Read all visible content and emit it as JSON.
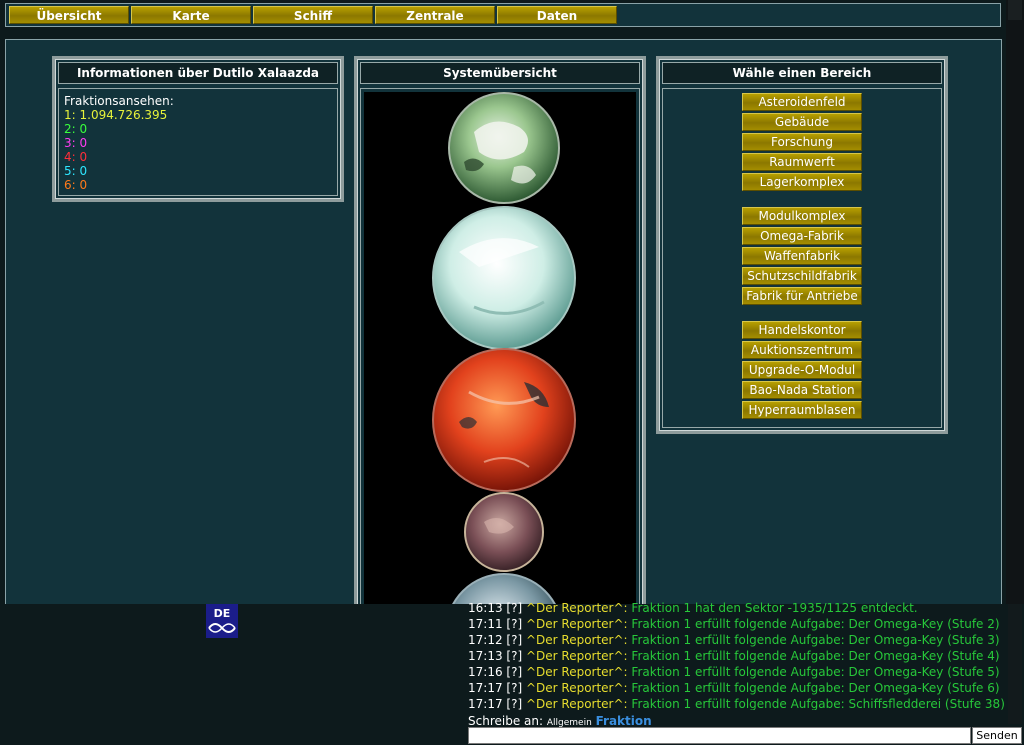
{
  "nav": [
    "Übersicht",
    "Karte",
    "Schiff",
    "Zentrale",
    "Daten"
  ],
  "info": {
    "title": "Informationen über Dutilo Xalaazda",
    "label": "Fraktionsansehen:",
    "rows": [
      {
        "key": "1:",
        "value": "1.094.726.395",
        "color": "#e6f23a"
      },
      {
        "key": "2:",
        "value": "0",
        "color": "#39ff3d"
      },
      {
        "key": "3:",
        "value": "0",
        "color": "#ff3cf2"
      },
      {
        "key": "4:",
        "value": "0",
        "color": "#ff2e3a"
      },
      {
        "key": "5:",
        "value": "0",
        "color": "#2ee6ff"
      },
      {
        "key": "6:",
        "value": "0",
        "color": "#ff7a1a"
      }
    ]
  },
  "system": {
    "title": "Systemübersicht",
    "planets": [
      "green-cloud-planet",
      "ice-planet",
      "red-lava-planet",
      "small-pink-planet",
      "partial-planet"
    ]
  },
  "areas": {
    "title": "Wähle einen Bereich",
    "group1": [
      "Asteroidenfeld",
      "Gebäude",
      "Forschung",
      "Raumwerft",
      "Lagerkomplex"
    ],
    "group2": [
      "Modulkomplex",
      "Omega-Fabrik",
      "Waffenfabrik",
      "Schutzschildfabrik",
      "Fabrik für Antriebe"
    ],
    "group3": [
      "Handelskontor",
      "Auktionszentrum",
      "Upgrade-O-Modul",
      "Bao-Nada Station",
      "Hyperraumblasen"
    ]
  },
  "chat": {
    "lines": [
      {
        "time": "16:13 [?]",
        "sender": "^Der Reporter^:",
        "text": "Fraktion 1 hat den Sektor -1935/1125 entdeckt."
      },
      {
        "time": "17:11 [?]",
        "sender": "^Der Reporter^:",
        "text": "Fraktion 1 erfüllt folgende Aufgabe: Der Omega-Key (Stufe 2)"
      },
      {
        "time": "17:12 [?]",
        "sender": "^Der Reporter^:",
        "text": "Fraktion 1 erfüllt folgende Aufgabe: Der Omega-Key (Stufe 3)"
      },
      {
        "time": "17:13 [?]",
        "sender": "^Der Reporter^:",
        "text": "Fraktion 1 erfüllt folgende Aufgabe: Der Omega-Key (Stufe 4)"
      },
      {
        "time": "17:16 [?]",
        "sender": "^Der Reporter^:",
        "text": "Fraktion 1 erfüllt folgende Aufgabe: Der Omega-Key (Stufe 5)"
      },
      {
        "time": "17:17 [?]",
        "sender": "^Der Reporter^:",
        "text": "Fraktion 1 erfüllt folgende Aufgabe: Der Omega-Key (Stufe 6)"
      },
      {
        "time": "17:17 [?]",
        "sender": "^Der Reporter^:",
        "text": "Fraktion 1 erfüllt folgende Aufgabe: Schiffsfledderei (Stufe 38)"
      }
    ],
    "write_label": "Schreibe an:",
    "channel_all": "Allgemein",
    "channel_faction": "Fraktion",
    "send_label": "Senden",
    "language_badge": "DE"
  }
}
